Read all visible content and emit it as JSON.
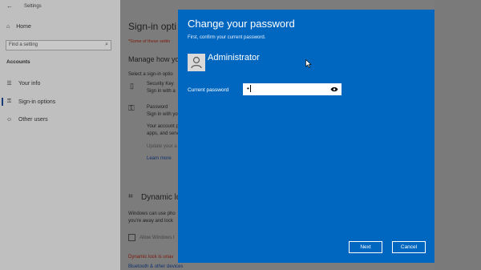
{
  "window": {
    "title": "Settings"
  },
  "sidebar": {
    "home": "Home",
    "search_placeholder": "Find a setting",
    "section": "Accounts",
    "items": [
      {
        "label": "Your info",
        "icon": "person-card-icon"
      },
      {
        "label": "Sign-in options",
        "icon": "key-icon",
        "active": true
      },
      {
        "label": "Other users",
        "icon": "people-icon"
      }
    ]
  },
  "main": {
    "heading": "Sign-in opti",
    "notice": "*Some of these settin",
    "manage": "Manage how yo",
    "select_option": "Select a sign-in optio",
    "security_key_title": "Security Key",
    "security_key_desc": "Sign in with a",
    "password_title": "Password",
    "password_desc": "Sign in with yo",
    "password_body_1": "Your account p",
    "password_body_2": "apps, and serv",
    "password_update": "Update your a",
    "learn_more": "Learn more",
    "dynamic_lock_title": "Dynamic lo",
    "dynamic_desc_1": "Windows can use pho",
    "dynamic_desc_2": "you're away and lock",
    "allow_windows": "Allow Windows t",
    "dynamic_unavailable": "Dynamic lock is unav",
    "bluetooth_link": "Bluetooth & other devices"
  },
  "dialog": {
    "title": "Change your password",
    "subtitle": "First, confirm your current password.",
    "username": "Administrator",
    "current_password_label": "Current password",
    "current_password_value": "•",
    "next_button": "Next",
    "cancel_button": "Cancel",
    "accent": "#0067c0"
  }
}
